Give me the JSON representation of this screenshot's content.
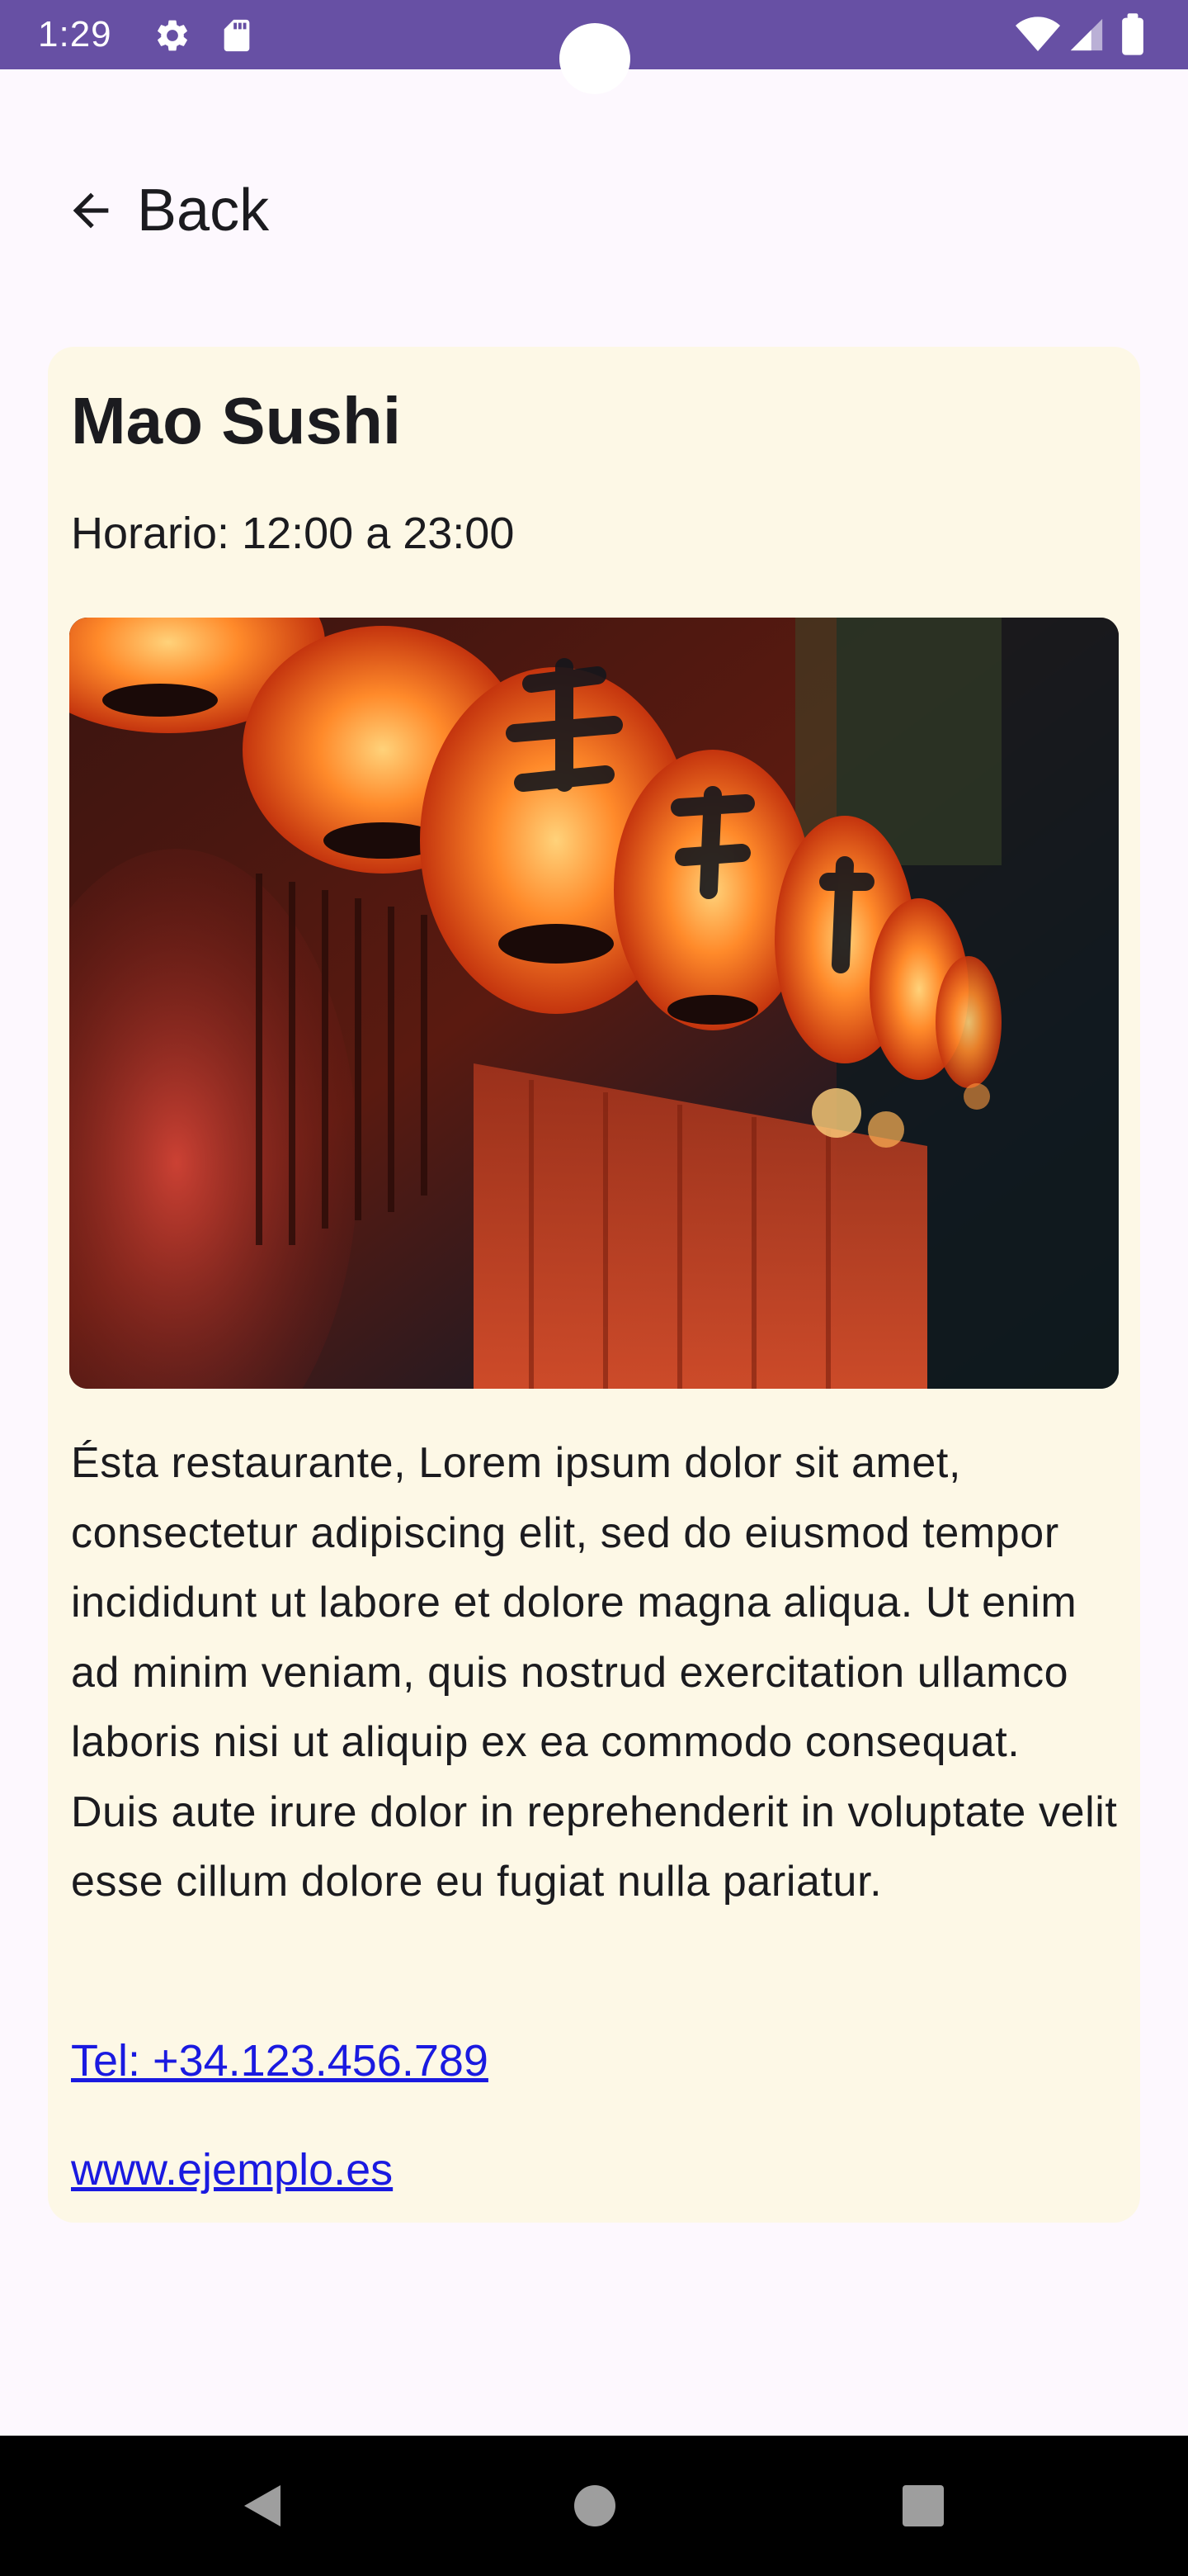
{
  "status_bar": {
    "time": "1:29",
    "icons": [
      "settings-icon",
      "sd-card-icon",
      "wifi-icon",
      "cellular-signal-icon",
      "battery-icon"
    ],
    "background_color": "#6750a4"
  },
  "navigation": {
    "back_label": "Back",
    "back_icon": "arrow-left-icon"
  },
  "restaurant": {
    "name": "Mao Sushi",
    "hours": "Horario: 12:00 a 23:00",
    "image_subject": "red paper lanterns at night",
    "description": "Ésta restaurante, Lorem ipsum dolor sit amet, consectetur adipiscing elit, sed do eiusmod tempor incididunt ut labore et dolore magna aliqua. Ut enim ad minim veniam, quis nostrud exercitation ullamco laboris nisi ut aliquip ex ea commodo consequat. Duis aute irure dolor in reprehenderit in voluptate velit esse cillum dolore eu fugiat nulla pariatur.",
    "phone_link": "Tel: +34.123.456.789",
    "website_link": "www.ejemplo.es"
  },
  "theme": {
    "card_background": "#fdf8e6",
    "page_background": "#fdf8fe",
    "link_color": "#1a1ae0"
  },
  "system_nav": {
    "buttons": [
      "nav-back-icon",
      "nav-home-icon",
      "nav-recents-icon"
    ]
  }
}
